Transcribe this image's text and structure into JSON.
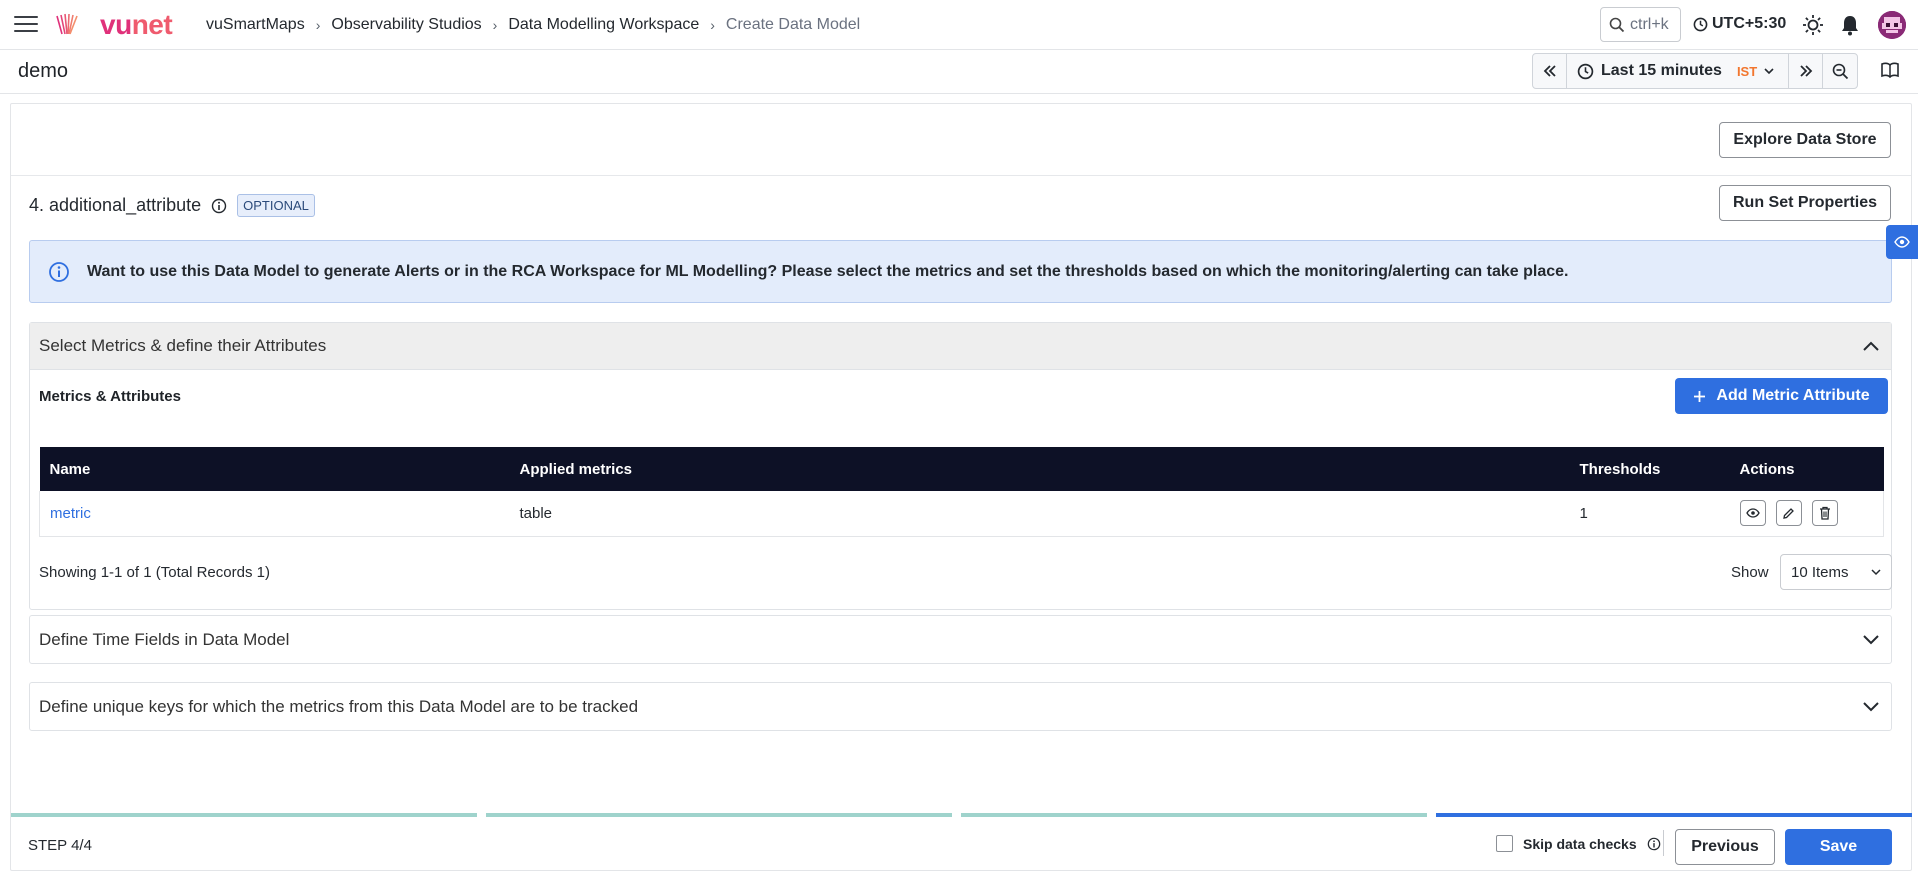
{
  "header": {
    "logo_text_a": "vu",
    "logo_text_b": "net",
    "breadcrumbs": [
      "vuSmartMaps",
      "Observability Studios",
      "Data Modelling Workspace",
      "Create Data Model"
    ],
    "search_shortcut": "ctrl+k",
    "timezone": "UTC+5:30"
  },
  "subbar": {
    "page_title": "demo",
    "time_range": "Last 15 minutes",
    "tz_badge": "IST"
  },
  "main": {
    "explore_button": "Explore Data Store",
    "section_title": "4. additional_attribute",
    "optional_badge": "OPTIONAL",
    "run_button": "Run Set Properties",
    "info_message": "Want to use this Data Model to generate Alerts or in the RCA Workspace for ML Modelling? Please select the metrics and set the thresholds based on which the monitoring/alerting can take place.",
    "accordions": [
      {
        "title": "Select Metrics & define their Attributes"
      },
      {
        "title": "Define Time Fields in Data Model"
      },
      {
        "title": "Define unique keys for which the metrics from this Data Model are to be tracked"
      }
    ],
    "metrics": {
      "title": "Metrics & Attributes",
      "add_button": "Add Metric Attribute",
      "columns": [
        "Name",
        "Applied metrics",
        "Thresholds",
        "Actions"
      ],
      "rows": [
        {
          "name": "metric",
          "applied": "table",
          "thresholds": "1"
        }
      ],
      "showing": "Showing 1-1 of 1 (Total Records 1)",
      "show_label": "Show",
      "page_size": "10 Items"
    }
  },
  "footer": {
    "step": "STEP 4/4",
    "progress_completed_steps": 4,
    "progress_total_steps": 4,
    "skip_label": "Skip data checks",
    "previous": "Previous",
    "save": "Save"
  },
  "colors": {
    "primary": "#2f6fe0",
    "brand_pink": "#e0317a",
    "table_header": "#0d1126",
    "progress_done": "#9fd3cc",
    "ist": "#f2762e"
  }
}
